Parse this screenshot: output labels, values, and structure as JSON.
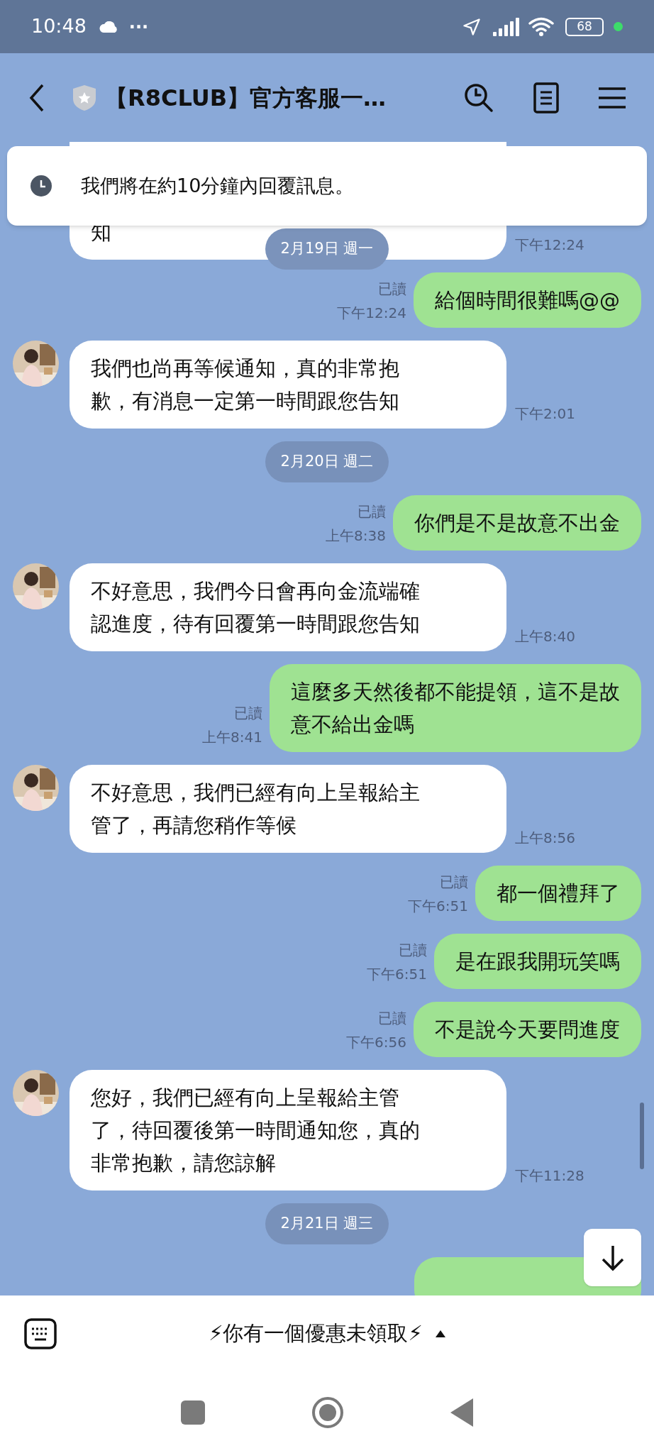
{
  "status_bar": {
    "time": "10:48",
    "dots": "···",
    "battery": "68"
  },
  "header": {
    "title": "【R8CLUB】官方客服一…"
  },
  "banner": {
    "text": "我們將在約10分鐘內回覆訊息。"
  },
  "messages": [
    {
      "kind": "in",
      "lines": [
        "知"
      ],
      "time": "下午12:24"
    },
    {
      "kind": "date",
      "text": "2月19日 週一",
      "pinned": true
    },
    {
      "kind": "out",
      "lines": [
        "給個時間很難嗎@@"
      ],
      "read": "已讀",
      "time": "下午12:24"
    },
    {
      "kind": "in",
      "lines": [
        "我們也尚再等候通知，真的非常抱",
        "歉，有消息一定第一時間跟您告知"
      ],
      "time": "下午2:01"
    },
    {
      "kind": "date",
      "text": "2月20日 週二",
      "pinned": false
    },
    {
      "kind": "out",
      "lines": [
        "你們是不是故意不出金"
      ],
      "read": "已讀",
      "time": "上午8:38"
    },
    {
      "kind": "in",
      "lines": [
        "不好意思，我們今日會再向金流端確",
        "認進度，待有回覆第一時間跟您告知"
      ],
      "time": "上午8:40"
    },
    {
      "kind": "out",
      "lines": [
        "這麼多天然後都不能提領，這不是故",
        "意不給出金嗎"
      ],
      "read": "已讀",
      "time": "上午8:41"
    },
    {
      "kind": "in",
      "lines": [
        "不好意思，我們已經有向上呈報給主",
        "管了，再請您稍作等候"
      ],
      "time": "上午8:56"
    },
    {
      "kind": "out",
      "lines": [
        "都一個禮拜了"
      ],
      "read": "已讀",
      "time": "下午6:51"
    },
    {
      "kind": "out",
      "lines": [
        "是在跟我開玩笑嗎"
      ],
      "read": "已讀",
      "time": "下午6:51"
    },
    {
      "kind": "out",
      "lines": [
        "不是說今天要問進度"
      ],
      "read": "已讀",
      "time": "下午6:56"
    },
    {
      "kind": "in",
      "lines": [
        "您好，我們已經有向上呈報給主管",
        "了，待回覆後第一時間通知您，真的",
        "非常抱歉，請您諒解"
      ],
      "time": "下午11:28"
    },
    {
      "kind": "date",
      "text": "2月21日 週三",
      "pinned": false
    },
    {
      "kind": "partial"
    }
  ],
  "bottom_bar": {
    "promo": "⚡你有一個優惠未領取⚡"
  }
}
